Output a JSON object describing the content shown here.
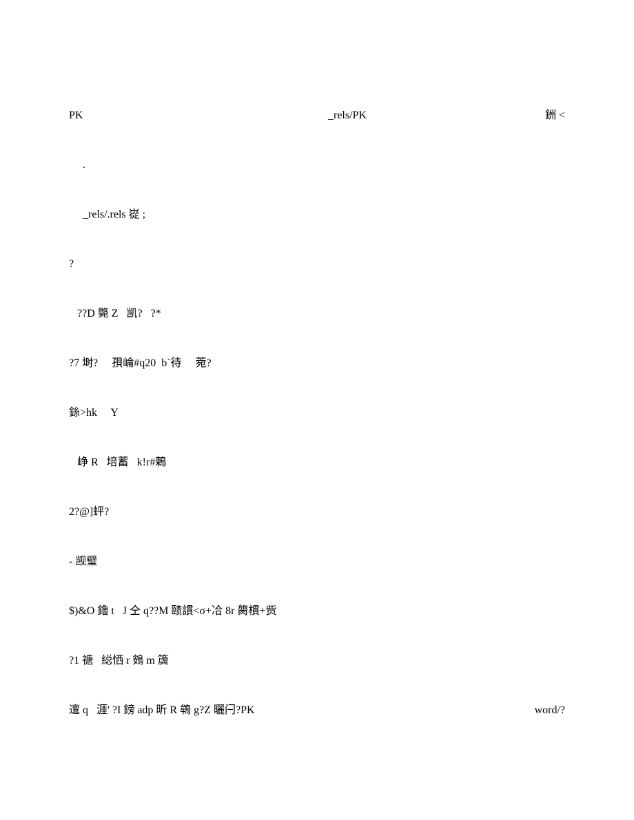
{
  "lines": {
    "l1_left": "PK",
    "l1_mid": "_rels/PK",
    "l1_right": "銂 <",
    "l2": "     .",
    "l3": "     _rels/.rels 嵸 ;",
    "l4": "?",
    "l5": "   ??D 斃 Z   凯?   ?*",
    "l6": "?7 埘?     孭崘#q20  b`待     菀?",
    "l7": "銯>hk     Y",
    "l8": "   峥 R   培蓄   k!r#鶫",
    "l9": "2?@]蚲?",
    "l10": "- 觊璧",
    "l11": "$)&O 鑥 t   J 仝 q??M 赜謴<σ+冾 8r 膐樌+赀",
    "l12": "?1 禟   縂恓 r 鴳 m 簴",
    "l13_left": "邅 q   涯' ?I 鎊 adp 昕 R 鴾 g?Z 曬闩?PK",
    "l13_right": "word/?"
  }
}
